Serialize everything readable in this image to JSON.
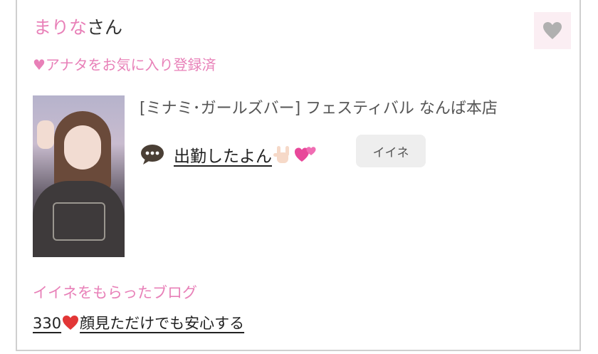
{
  "profile": {
    "name": "まりな",
    "name_suffix": "さん",
    "favorite_status": "♥アナタをお気に入り登録済"
  },
  "favorite_button": {
    "icon": "heart-icon",
    "color": "#b0b0b0"
  },
  "post": {
    "shop": "[ミナミ･ガールズバー]  フェスティバル なんば本店",
    "status_text": "出勤したよん",
    "status_icon": "speech-bubble-icon",
    "like_label": "イイネ"
  },
  "blog": {
    "heading": "イイネをもらったブログ",
    "count": "330",
    "title": "顔見ただけでも安心する"
  },
  "colors": {
    "accent_pink": "#e880b8",
    "text": "#222222",
    "border": "#cfcfcf"
  }
}
